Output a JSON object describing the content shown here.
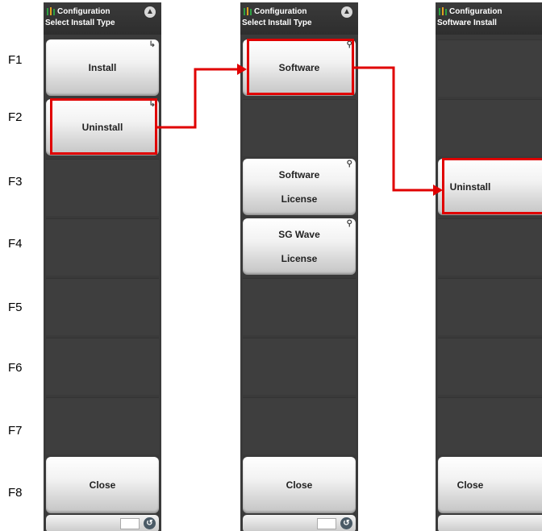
{
  "f_labels": [
    "F1",
    "F2",
    "F3",
    "F4",
    "F5",
    "F6",
    "F7",
    "F8"
  ],
  "panel1": {
    "title": "Configuration",
    "subtitle": "Select Install Type",
    "keys": {
      "install": "Install",
      "uninstall": "Uninstall",
      "close": "Close"
    }
  },
  "panel2": {
    "title": "Configuration",
    "subtitle": "Select Install Type",
    "keys": {
      "software": "Software",
      "software_license_1": "Software",
      "software_license_2": "License",
      "sg_wave_license_1": "SG Wave",
      "sg_wave_license_2": "License",
      "close": "Close"
    }
  },
  "panel3": {
    "title": "Configuration",
    "subtitle": "Software Install",
    "keys": {
      "uninstall": "Uninstall",
      "close": "Close"
    }
  },
  "colors": {
    "highlight": "#e00000",
    "panel_bg": "#3a3a3a",
    "key_face": "#e8e8e8"
  },
  "icons": {
    "logo": "configuration-logo-icon",
    "up": "scroll-up-icon",
    "submenu": "submenu-arrow-icon",
    "locked": "lock-icon",
    "back": "back-circle-icon"
  }
}
